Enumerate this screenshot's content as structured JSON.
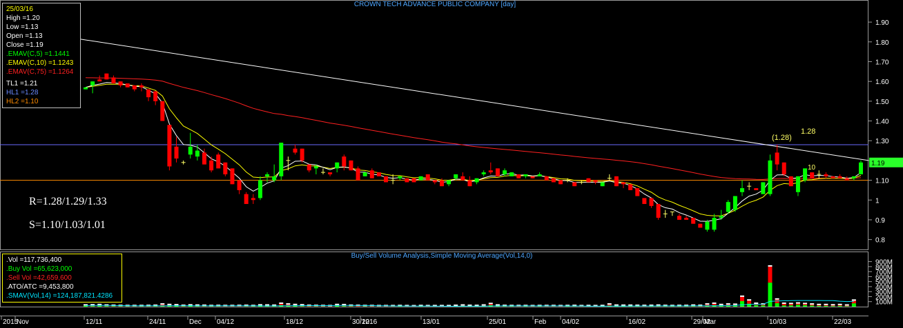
{
  "header": {
    "title": "CROWN TECH ADVANCE PUBLIC COMPANY [day]"
  },
  "info_box": {
    "date": "25/03/16",
    "high": "High  =1.20",
    "low": "Low  =1.13",
    "open": "Open  =1.13",
    "close": "Close  =1.19",
    "ema5": ".EMAV(C,5)   =1.1441",
    "ema10": ".EMAV(C,10)  =1.1243",
    "ema75": ".EMAV(C,75)  =1.1264",
    "tl1": "TL1 =1.21",
    "hl1": "HL1 =1.28",
    "hl2": "HL2 =1.10"
  },
  "annotations": {
    "resistance": "R=1.28/1.29/1.33",
    "support": "S=1.10/1.03/1.01",
    "hl1_label": "1.28",
    "peak_label": "(1.28)",
    "hl2_label": "10",
    "last_price": "1.19"
  },
  "volume_panel": {
    "title": "Buy/Sell Volume Analysis,Simple Moving Average(Vol,14,0)",
    "vol": ".Vol    =117,736,400",
    "buy": ".Buy Vol   =65,623,000",
    "sell": ".Sell Vol   =42,659,600",
    "ato": ".ATO/ATC    =9,453,800",
    "smav": ".SMAV(Vol,14)   =124,187,821.4286"
  },
  "colors": {
    "up": "#00ff00",
    "down": "#ff0000",
    "ema5": "#ffffff",
    "ema10": "#ffff00",
    "ema75": "#ff2020",
    "hl1": "#6a6aff",
    "hl2": "#ff8c00",
    "trend": "#ffffff"
  },
  "chart_data": {
    "type": "candlestick",
    "title": "CROWN TECH ADVANCE PUBLIC COMPANY [day]",
    "ylim": [
      0.75,
      1.97
    ],
    "y_ticks": [
      0.8,
      0.9,
      1,
      1.1,
      1.2,
      1.3,
      1.4,
      1.5,
      1.6,
      1.7,
      1.8,
      1.9
    ],
    "y_tick_labels": [
      "0.8",
      "0.9",
      "1",
      "1.10",
      "1.20",
      "1.30",
      "1.40",
      "1.50",
      "1.60",
      "1.70",
      "1.80",
      "1.90"
    ],
    "x_labels": [
      "2015",
      "Nov",
      "12/11",
      "24/11",
      "Dec",
      "04/12",
      "18/12",
      "30/12",
      "2016",
      "13/01",
      "25/01",
      "Feb",
      "04/02",
      "16/02",
      "29/02",
      "Mar",
      "10/03",
      "22/03"
    ],
    "horizontal_lines": {
      "HL1": 1.28,
      "HL2": 1.1
    },
    "trend_line": {
      "start": 1.82,
      "end": 1.2
    },
    "candles": [
      [
        1.56,
        1.57,
        1.56,
        1.57
      ],
      [
        1.58,
        1.6,
        1.54,
        1.6
      ],
      [
        1.61,
        1.63,
        1.6,
        1.6
      ],
      [
        1.64,
        1.64,
        1.61,
        1.61
      ],
      [
        1.62,
        1.63,
        1.59,
        1.59
      ],
      [
        1.6,
        1.6,
        1.57,
        1.58
      ],
      [
        1.59,
        1.59,
        1.57,
        1.57
      ],
      [
        1.58,
        1.58,
        1.55,
        1.56
      ],
      [
        1.58,
        1.59,
        1.55,
        1.57
      ],
      [
        1.56,
        1.56,
        1.5,
        1.52
      ],
      [
        1.55,
        1.55,
        1.48,
        1.5
      ],
      [
        1.5,
        1.5,
        1.4,
        1.4
      ],
      [
        1.38,
        1.38,
        1.15,
        1.17
      ],
      [
        1.27,
        1.32,
        1.19,
        1.21
      ],
      [
        1.19,
        1.2,
        1.18,
        1.19
      ],
      [
        1.23,
        1.34,
        1.21,
        1.27
      ],
      [
        1.22,
        1.28,
        1.2,
        1.25
      ],
      [
        1.24,
        1.26,
        1.18,
        1.18
      ],
      [
        1.2,
        1.22,
        1.14,
        1.15
      ],
      [
        1.23,
        1.24,
        1.16,
        1.16
      ],
      [
        1.19,
        1.19,
        1.12,
        1.13
      ],
      [
        1.16,
        1.16,
        1.08,
        1.08
      ],
      [
        1.1,
        1.1,
        1.03,
        1.05
      ],
      [
        1.03,
        1.04,
        0.98,
        0.98
      ],
      [
        1.01,
        1.03,
        0.98,
        1.0
      ],
      [
        1.01,
        1.12,
        1.0,
        1.1
      ],
      [
        1.12,
        1.14,
        1.09,
        1.13
      ],
      [
        1.1,
        1.18,
        1.09,
        1.12
      ],
      [
        1.12,
        1.29,
        1.1,
        1.29
      ],
      [
        1.2,
        1.22,
        1.15,
        1.2
      ],
      [
        1.26,
        1.28,
        1.23,
        1.24
      ],
      [
        1.26,
        1.26,
        1.19,
        1.2
      ],
      [
        1.18,
        1.18,
        1.14,
        1.15
      ],
      [
        1.16,
        1.18,
        1.13,
        1.17
      ],
      [
        1.14,
        1.16,
        1.13,
        1.14
      ],
      [
        1.14,
        1.14,
        1.12,
        1.13
      ],
      [
        1.16,
        1.19,
        1.14,
        1.19
      ],
      [
        1.22,
        1.23,
        1.15,
        1.17
      ],
      [
        1.2,
        1.2,
        1.15,
        1.15
      ],
      [
        1.16,
        1.17,
        1.1,
        1.1
      ],
      [
        1.12,
        1.14,
        1.12,
        1.14
      ],
      [
        1.15,
        1.16,
        1.11,
        1.11
      ],
      [
        1.14,
        1.14,
        1.12,
        1.12
      ],
      [
        1.12,
        1.12,
        1.09,
        1.09
      ],
      [
        1.1,
        1.13,
        1.08,
        1.1
      ],
      [
        1.11,
        1.12,
        1.1,
        1.12
      ],
      [
        1.11,
        1.11,
        1.09,
        1.09
      ],
      [
        1.11,
        1.11,
        1.09,
        1.09
      ],
      [
        1.1,
        1.12,
        1.1,
        1.12
      ],
      [
        1.13,
        1.13,
        1.1,
        1.1
      ],
      [
        1.1,
        1.1,
        1.08,
        1.09
      ],
      [
        1.1,
        1.11,
        1.07,
        1.07
      ],
      [
        1.08,
        1.1,
        1.07,
        1.1
      ],
      [
        1.11,
        1.13,
        1.1,
        1.13
      ],
      [
        1.12,
        1.14,
        1.1,
        1.1
      ],
      [
        1.1,
        1.12,
        1.07,
        1.07
      ],
      [
        1.09,
        1.11,
        1.08,
        1.11
      ],
      [
        1.13,
        1.15,
        1.12,
        1.14
      ],
      [
        1.15,
        1.19,
        1.13,
        1.14
      ],
      [
        1.16,
        1.16,
        1.12,
        1.12
      ],
      [
        1.13,
        1.16,
        1.12,
        1.15
      ],
      [
        1.12,
        1.14,
        1.12,
        1.14
      ],
      [
        1.13,
        1.13,
        1.11,
        1.11
      ],
      [
        1.12,
        1.13,
        1.11,
        1.13
      ],
      [
        1.12,
        1.12,
        1.11,
        1.11
      ],
      [
        1.12,
        1.14,
        1.12,
        1.13
      ],
      [
        1.12,
        1.12,
        1.1,
        1.1
      ],
      [
        1.11,
        1.11,
        1.09,
        1.09
      ],
      [
        1.1,
        1.1,
        1.08,
        1.08
      ],
      [
        1.1,
        1.11,
        1.09,
        1.1
      ],
      [
        1.09,
        1.09,
        1.07,
        1.07
      ],
      [
        1.09,
        1.1,
        1.08,
        1.09
      ],
      [
        1.11,
        1.11,
        1.09,
        1.09
      ],
      [
        1.1,
        1.1,
        1.08,
        1.09
      ],
      [
        1.07,
        1.09,
        1.07,
        1.09
      ],
      [
        1.11,
        1.13,
        1.1,
        1.11
      ],
      [
        1.12,
        1.12,
        1.07,
        1.07
      ],
      [
        1.09,
        1.09,
        1.06,
        1.08
      ],
      [
        1.08,
        1.08,
        1.05,
        1.05
      ],
      [
        1.06,
        1.06,
        1.02,
        1.02
      ],
      [
        1.01,
        1.01,
        0.98,
        0.98
      ],
      [
        1.01,
        1.01,
        0.96,
        0.97
      ],
      [
        0.98,
        0.98,
        0.9,
        0.91
      ],
      [
        0.93,
        0.95,
        0.91,
        0.93
      ],
      [
        0.94,
        0.94,
        0.92,
        0.94
      ],
      [
        0.92,
        0.93,
        0.9,
        0.9
      ],
      [
        0.91,
        0.92,
        0.9,
        0.9
      ],
      [
        0.91,
        0.91,
        0.88,
        0.88
      ],
      [
        0.88,
        0.88,
        0.86,
        0.86
      ],
      [
        0.85,
        0.9,
        0.84,
        0.89
      ],
      [
        0.85,
        0.93,
        0.84,
        0.91
      ],
      [
        0.91,
        0.95,
        0.9,
        0.92
      ],
      [
        0.94,
        1.0,
        0.93,
        0.99
      ],
      [
        0.95,
        1.02,
        0.94,
        1.02
      ],
      [
        1.04,
        1.1,
        1.02,
        1.06
      ],
      [
        1.07,
        1.09,
        1.05,
        1.07
      ],
      [
        1.06,
        1.06,
        1.05,
        1.05
      ],
      [
        1.03,
        1.09,
        1.03,
        1.09
      ],
      [
        1.03,
        1.23,
        1.02,
        1.2
      ],
      [
        1.24,
        1.28,
        1.15,
        1.18
      ],
      [
        1.19,
        1.19,
        1.12,
        1.13
      ],
      [
        1.12,
        1.12,
        1.07,
        1.07
      ],
      [
        1.04,
        1.12,
        1.02,
        1.12
      ],
      [
        1.1,
        1.16,
        1.09,
        1.16
      ],
      [
        1.14,
        1.14,
        1.11,
        1.11
      ],
      [
        1.13,
        1.15,
        1.11,
        1.13
      ],
      [
        1.13,
        1.14,
        1.11,
        1.12
      ],
      [
        1.12,
        1.12,
        1.11,
        1.11
      ],
      [
        1.12,
        1.13,
        1.11,
        1.11
      ],
      [
        1.11,
        1.12,
        1.1,
        1.1
      ],
      [
        1.11,
        1.12,
        1.1,
        1.12
      ],
      [
        1.13,
        1.2,
        1.13,
        1.19
      ]
    ],
    "volume_ylim": [
      0,
      950
    ],
    "volume_ticks": [
      100,
      200,
      300,
      400,
      500,
      600,
      700,
      800,
      900
    ],
    "volume_tick_labels": [
      "100M",
      "200M",
      "300M",
      "400M",
      "500M",
      "600M",
      "700M",
      "800M",
      "900M"
    ],
    "volume": [
      [
        22,
        20,
        18
      ],
      [
        25,
        12,
        22
      ],
      [
        30,
        15,
        25
      ],
      [
        20,
        12,
        18
      ],
      [
        15,
        10,
        12
      ],
      [
        12,
        8,
        10
      ],
      [
        10,
        6,
        8
      ],
      [
        10,
        5,
        8
      ],
      [
        10,
        6,
        8
      ],
      [
        12,
        6,
        10
      ],
      [
        15,
        8,
        12
      ],
      [
        40,
        12,
        30
      ],
      [
        30,
        20,
        18
      ],
      [
        25,
        14,
        16
      ],
      [
        14,
        8,
        10
      ],
      [
        22,
        14,
        12
      ],
      [
        18,
        10,
        10
      ],
      [
        15,
        6,
        12
      ],
      [
        10,
        6,
        8
      ],
      [
        12,
        6,
        10
      ],
      [
        10,
        4,
        8
      ],
      [
        10,
        4,
        8
      ],
      [
        12,
        4,
        10
      ],
      [
        14,
        6,
        10
      ],
      [
        10,
        6,
        6
      ],
      [
        22,
        14,
        10
      ],
      [
        20,
        10,
        12
      ],
      [
        16,
        8,
        10
      ],
      [
        55,
        30,
        30
      ],
      [
        40,
        20,
        26
      ],
      [
        30,
        16,
        20
      ],
      [
        24,
        10,
        18
      ],
      [
        14,
        6,
        10
      ],
      [
        12,
        6,
        8
      ],
      [
        10,
        5,
        7
      ],
      [
        8,
        4,
        6
      ],
      [
        30,
        18,
        14
      ],
      [
        28,
        12,
        18
      ],
      [
        16,
        8,
        10
      ],
      [
        14,
        4,
        10
      ],
      [
        10,
        6,
        6
      ],
      [
        10,
        4,
        8
      ],
      [
        8,
        4,
        6
      ],
      [
        8,
        3,
        6
      ],
      [
        8,
        4,
        6
      ],
      [
        10,
        6,
        6
      ],
      [
        8,
        4,
        6
      ],
      [
        6,
        2,
        4
      ],
      [
        10,
        6,
        6
      ],
      [
        8,
        4,
        6
      ],
      [
        8,
        4,
        6
      ],
      [
        8,
        3,
        6
      ],
      [
        8,
        4,
        6
      ],
      [
        14,
        8,
        8
      ],
      [
        20,
        10,
        12
      ],
      [
        14,
        6,
        10
      ],
      [
        12,
        6,
        8
      ],
      [
        20,
        10,
        12
      ],
      [
        50,
        28,
        24
      ],
      [
        20,
        10,
        12
      ],
      [
        12,
        6,
        8
      ],
      [
        10,
        6,
        6
      ],
      [
        10,
        4,
        8
      ],
      [
        10,
        6,
        6
      ],
      [
        8,
        4,
        6
      ],
      [
        10,
        6,
        6
      ],
      [
        10,
        4,
        8
      ],
      [
        10,
        4,
        8
      ],
      [
        8,
        3,
        6
      ],
      [
        10,
        6,
        6
      ],
      [
        12,
        5,
        8
      ],
      [
        8,
        4,
        6
      ],
      [
        10,
        5,
        7
      ],
      [
        8,
        4,
        6
      ],
      [
        10,
        6,
        6
      ],
      [
        40,
        22,
        20
      ],
      [
        18,
        8,
        12
      ],
      [
        16,
        8,
        10
      ],
      [
        16,
        6,
        12
      ],
      [
        14,
        6,
        10
      ],
      [
        12,
        4,
        10
      ],
      [
        14,
        6,
        10
      ],
      [
        18,
        6,
        14
      ],
      [
        12,
        6,
        8
      ],
      [
        10,
        6,
        6
      ],
      [
        12,
        6,
        8
      ],
      [
        12,
        6,
        8
      ],
      [
        18,
        8,
        12
      ],
      [
        14,
        6,
        10
      ],
      [
        40,
        20,
        22
      ],
      [
        55,
        30,
        28
      ],
      [
        30,
        18,
        14
      ],
      [
        40,
        24,
        18
      ],
      [
        35,
        20,
        18
      ],
      [
        195,
        110,
        90
      ],
      [
        120,
        60,
        70
      ],
      [
        55,
        30,
        28
      ],
      [
        40,
        25,
        18
      ],
      [
        800,
        480,
        330
      ],
      [
        140,
        70,
        80
      ],
      [
        55,
        25,
        32
      ],
      [
        50,
        25,
        28
      ],
      [
        60,
        38,
        24
      ],
      [
        50,
        30,
        22
      ],
      [
        40,
        22,
        20
      ],
      [
        30,
        16,
        16
      ],
      [
        30,
        16,
        16
      ],
      [
        24,
        12,
        14
      ],
      [
        30,
        16,
        16
      ],
      [
        20,
        10,
        12
      ],
      [
        118,
        66,
        43
      ]
    ]
  }
}
